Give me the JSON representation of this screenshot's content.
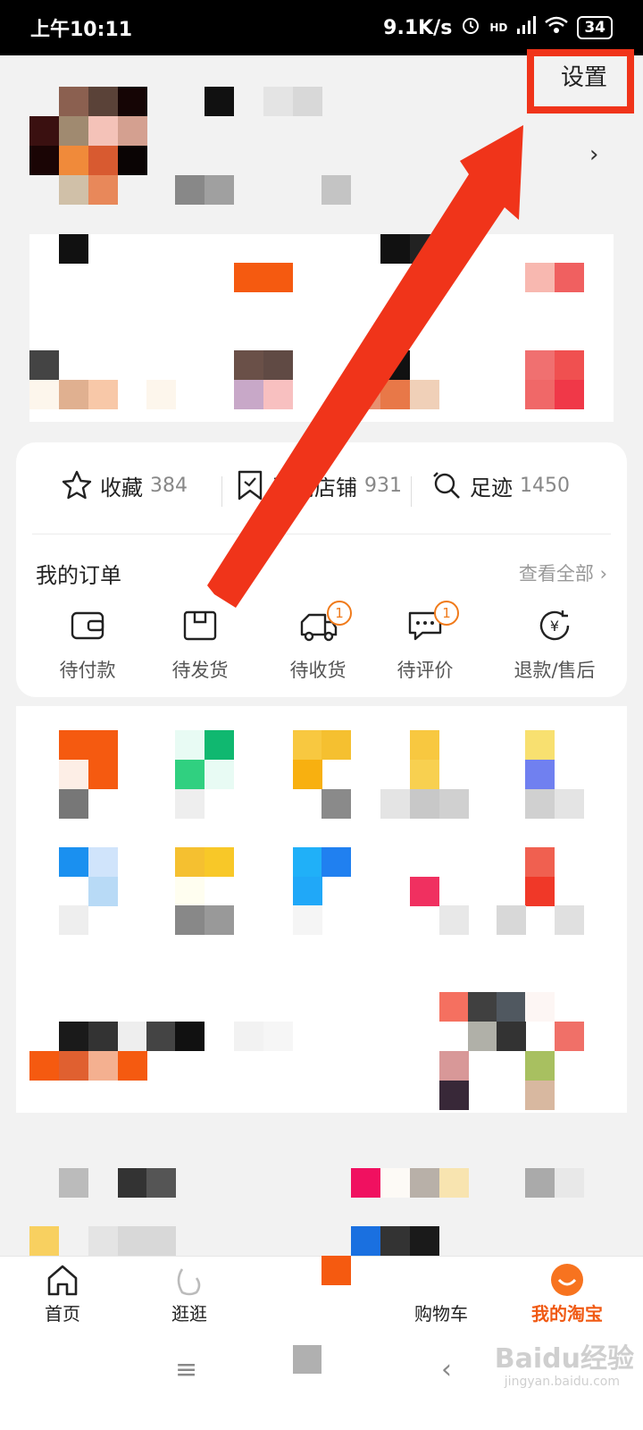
{
  "status_bar": {
    "time": "上午10:11",
    "net_speed": "9.1K/s",
    "network": "HD",
    "battery": "34"
  },
  "header": {
    "settings_label": "设置"
  },
  "stats": [
    {
      "label": "收藏",
      "count": "384",
      "icon": "star-icon"
    },
    {
      "label": "订阅店铺",
      "count": "931",
      "icon": "bookmark-icon"
    },
    {
      "label": "足迹",
      "count": "1450",
      "icon": "footprint-icon"
    }
  ],
  "orders": {
    "title": "我的订单",
    "view_all": "查看全部",
    "items": [
      {
        "label": "待付款",
        "icon": "wallet-icon",
        "badge": ""
      },
      {
        "label": "待发货",
        "icon": "box-icon",
        "badge": ""
      },
      {
        "label": "待收货",
        "icon": "truck-icon",
        "badge": "1"
      },
      {
        "label": "待评价",
        "icon": "comment-icon",
        "badge": "1"
      },
      {
        "label": "退款/售后",
        "icon": "refund-icon",
        "badge": ""
      }
    ]
  },
  "bottom_nav": {
    "items": [
      {
        "label": "首页",
        "icon": "home-icon",
        "active": false
      },
      {
        "label": "逛逛",
        "icon": "explore-icon",
        "active": false
      },
      {
        "label": "购物车",
        "icon": "cart-icon",
        "active": false
      },
      {
        "label": "我的淘宝",
        "icon": "profile-icon",
        "active": true
      }
    ]
  },
  "watermark": {
    "brand": "Baidu经验",
    "url": "jingyan.baidu.com"
  },
  "colors": {
    "accent": "#f05a14",
    "highlight": "#f0341a",
    "badge": "#f07a1a"
  }
}
